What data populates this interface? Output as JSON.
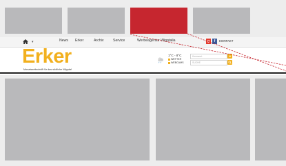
{
  "nav": {
    "items": [
      "News",
      "Erker",
      "Archiv",
      "Service",
      "Werbeagentur Wipptalia"
    ],
    "kontakt": "KONTAKT"
  },
  "logo": {
    "title": "Erker",
    "tagline": "Monatszeitschrift für das südliche Wipptal"
  },
  "weather": {
    "temp": "1°C - 8°C",
    "links": [
      "WETTER",
      "WEBCAMS"
    ]
  },
  "search": {
    "field_1_placeholder": "Kennwort",
    "field_2_placeholder": "SUCHE"
  },
  "colors": {
    "brand": "#f2b01e",
    "ad_red": "#c6262f",
    "placeholder_gray": "#b9b9bb",
    "callout": "#c6262f"
  },
  "icons": [
    "home-icon",
    "google-plus-icon",
    "facebook-icon",
    "kontakt-icon",
    "weather-icon",
    "login-icon",
    "search-icon"
  ]
}
